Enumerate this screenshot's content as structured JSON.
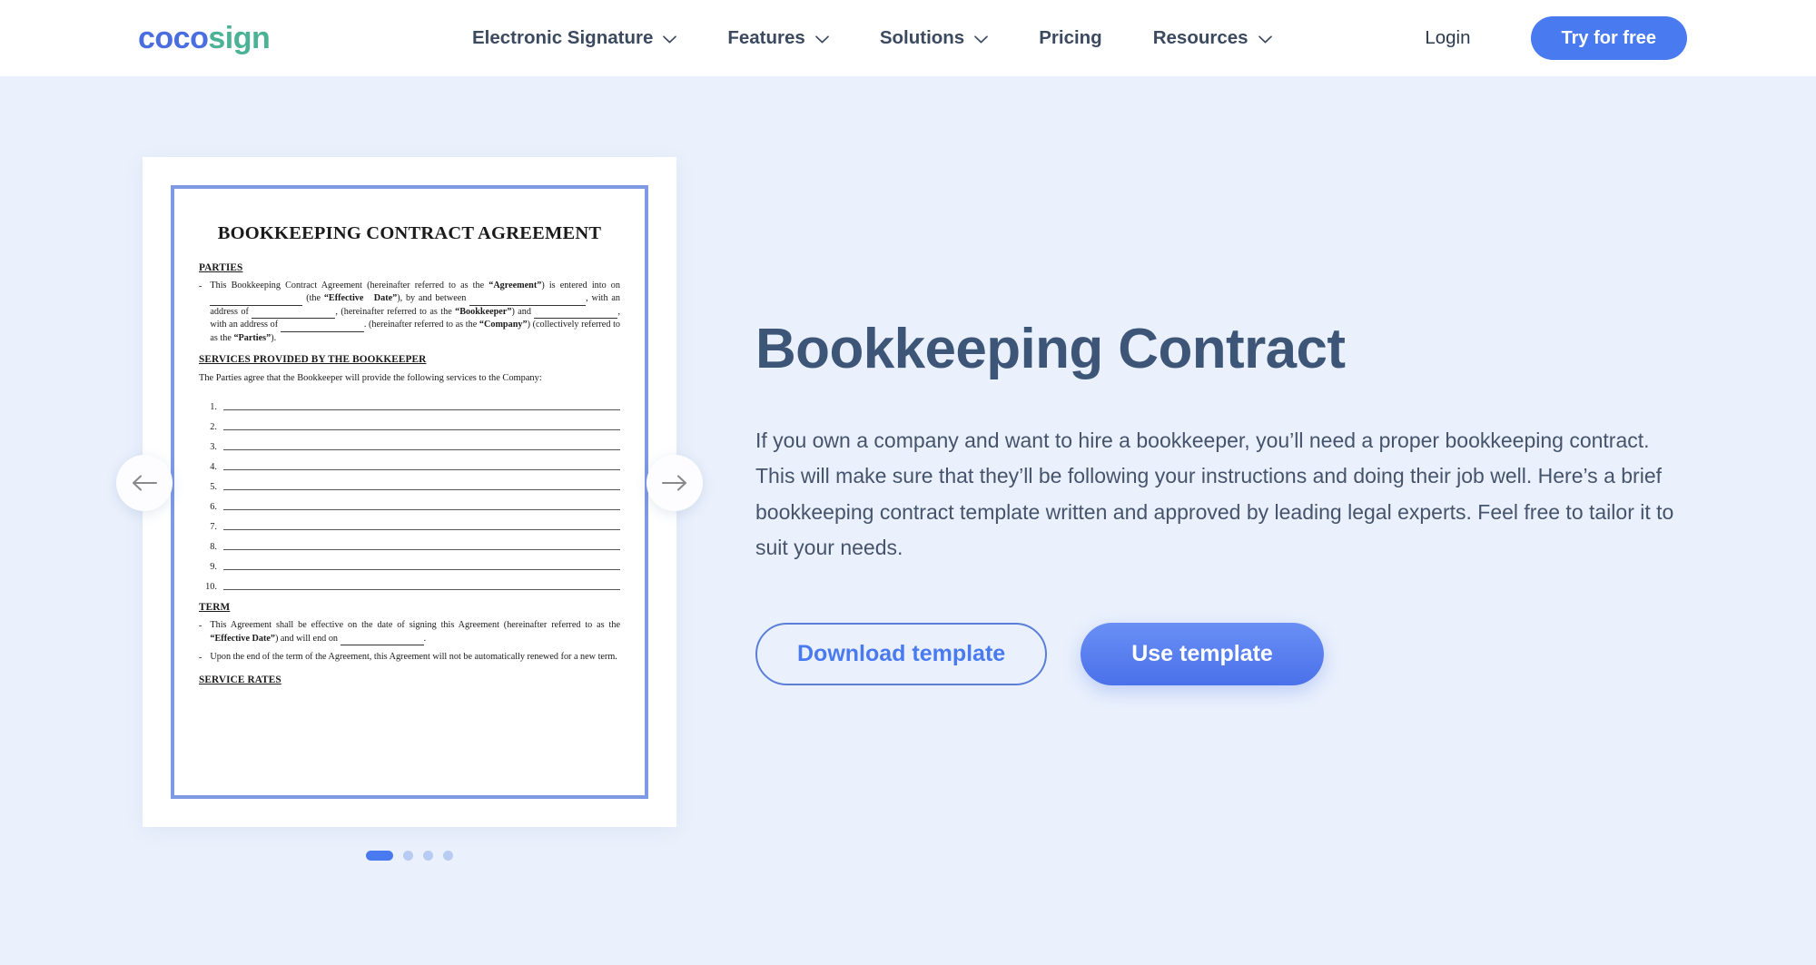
{
  "header": {
    "logo": {
      "part1": "coco",
      "part2": "sign",
      "color1": "#4a6ee0",
      "color2": "#4cb295"
    },
    "nav": [
      {
        "label": "Electronic Signature",
        "has_dropdown": true
      },
      {
        "label": "Features",
        "has_dropdown": true
      },
      {
        "label": "Solutions",
        "has_dropdown": true
      },
      {
        "label": "Pricing",
        "has_dropdown": false
      },
      {
        "label": "Resources",
        "has_dropdown": true
      }
    ],
    "login_label": "Login",
    "cta_label": "Try for free",
    "cta_color": "#4a7af0"
  },
  "carousel": {
    "prev_label": "Previous template",
    "next_label": "Next template",
    "total_slides": 4,
    "active_slide": 1,
    "document": {
      "title": "BOOKKEEPING CONTRACT AGREEMENT",
      "sections": [
        {
          "heading": "PARTIES",
          "bullets": [
            "This Bookkeeping Contract Agreement (hereinafter referred to as the “Agreement”) is entered into on ________ (the “Effective Date”), by and between ____________, with an address of ________, (hereinafter referred to as the “Bookkeeper”) and ________, with an address of ________, (hereinafter referred to as the “Company”) (collectively referred to as the “Parties”)."
          ]
        },
        {
          "heading": "SERVICES PROVIDED BY THE BOOKKEEPER",
          "lead": "The Parties agree that the Bookkeeper will provide the following services to the Company:",
          "numbered_blanks": [
            "1.",
            "2.",
            "3.",
            "4.",
            "5.",
            "6.",
            "7.",
            "8.",
            "9.",
            "10."
          ]
        },
        {
          "heading": "TERM",
          "bullets": [
            "This Agreement shall be effective on the date of signing this Agreement (hereinafter referred to as the “Effective Date”) and will end on ________.",
            "Upon the end of the term of the Agreement, this Agreement will not be automatically renewed for a new term."
          ]
        },
        {
          "heading": "SERVICE RATES"
        }
      ]
    }
  },
  "main": {
    "title": "Bookkeeping Contract",
    "description": "If you own a company and want to hire a bookkeeper, you’ll need a proper bookkeeping contract. This will make sure that they’ll be following your instructions and doing their job well. Here’s a brief bookkeeping contract template written and approved by leading legal experts. Feel free to tailor it to suit your needs.",
    "download_label": "Download template",
    "use_label": "Use template"
  },
  "colors": {
    "page_background": "#eaf1fc",
    "header_background": "#ffffff",
    "heading_text": "#3d5677",
    "body_text": "#45546c",
    "primary_blue": "#4a7af0",
    "doc_frame_border": "#7e9ae4",
    "dot_inactive": "#b8cbf2"
  }
}
